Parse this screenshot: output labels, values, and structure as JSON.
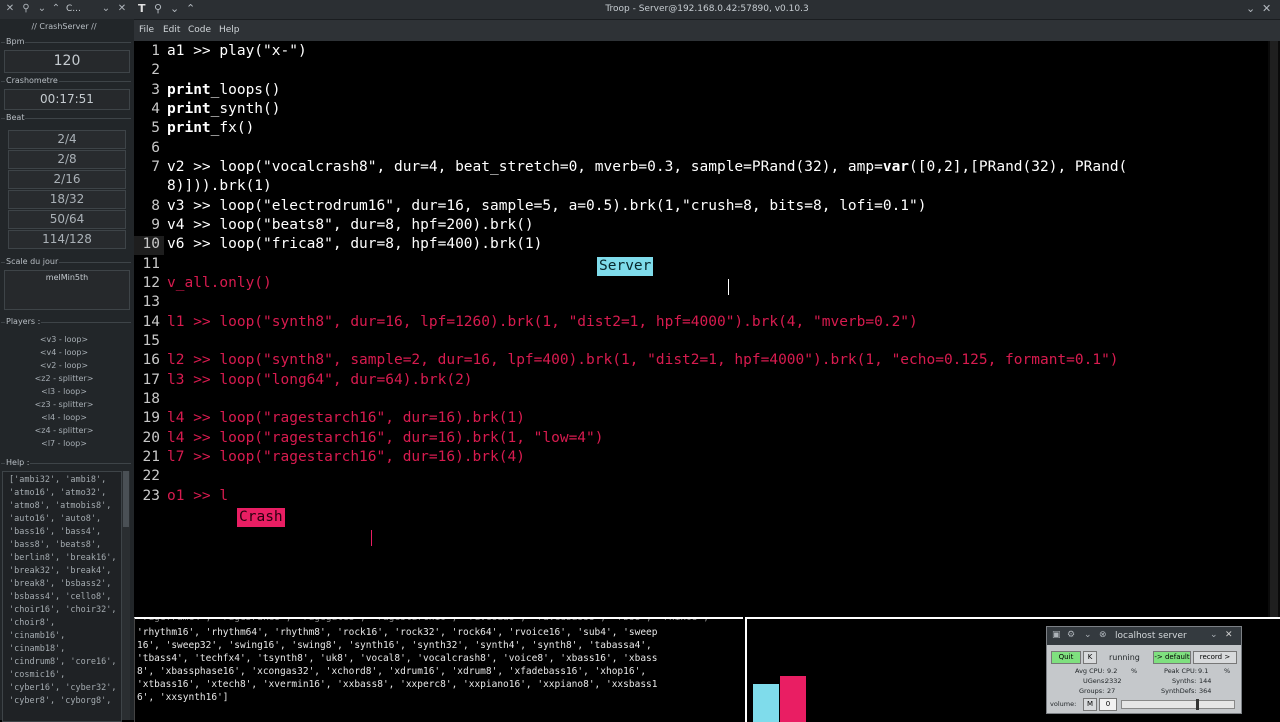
{
  "left_window": {
    "title": "// CrashServer //",
    "bpm_label": "Bpm",
    "bpm_value": "120",
    "chrono_label": "Crashometre",
    "chrono_value": "00:17:51",
    "beat_label": "Beat",
    "beat_buttons": [
      "2/4",
      "2/8",
      "2/16",
      "18/32",
      "50/64",
      "114/128"
    ],
    "scale_label": "Scale du jour",
    "scale_value": "melMin5th",
    "players_label": "Players :",
    "players": [
      "<v3 - loop>",
      "<v4 - loop>",
      "<v2 - loop>",
      "<z2 - splitter>",
      "<l3 - loop>",
      "<z3 - splitter>",
      "<l4 - loop>",
      "<z4 - splitter>",
      "<l7 - loop>"
    ],
    "help_label": "Help :",
    "help_lines": [
      "['ambi32', 'ambi8',",
      "'atmo16', 'atmo32',",
      "'atmo8', 'atmobis8',",
      "'auto16', 'auto8',",
      "'bass16', 'bass4',",
      "'bass8', 'beats8',",
      "'berlin8', 'break16',",
      "'break32', 'break4',",
      "'break8', 'bsbass2',",
      "'bsbass4', 'cello8',",
      "'choir16', 'choir32',",
      "'choir8',",
      "'cinamb16',",
      "'cinamb18',",
      "'cindrum8', 'core16',",
      "'cosmic16',",
      "'cyber16', 'cyber32',",
      "'cyber8', 'cyborg8',"
    ]
  },
  "troop": {
    "title": "Troop - Server@192.168.0.42:57890, v0.10.3",
    "menu": [
      "File",
      "Edit",
      "Code",
      "Help"
    ],
    "lines": [
      {
        "n": "1",
        "text": "a1 >> play(\"x-\")",
        "color": "white"
      },
      {
        "n": "2",
        "text": "",
        "color": "white"
      },
      {
        "n": "3",
        "kw": "print",
        "text": "_loops()",
        "color": "white"
      },
      {
        "n": "4",
        "kw": "print",
        "text": "_synth()",
        "color": "white"
      },
      {
        "n": "5",
        "kw": "print",
        "text": "_fx()",
        "color": "white"
      },
      {
        "n": "6",
        "text": "",
        "color": "white"
      },
      {
        "n": "7",
        "text": "v2 >> loop(\"vocalcrash8\", dur=4, beat_stretch=0, mverb=0.3, sample=PRand(32), amp=",
        "kw2": "var",
        "text2": "([0,2],[PRand(32), PRand(",
        "color": "white"
      },
      {
        "n": "",
        "text": "8)])).brk(1)",
        "color": "white"
      },
      {
        "n": "8",
        "text": "v3 >> loop(\"electrodrum16\", dur=16, sample=5, a=0.5).brk(1,\"crush=8, bits=8, lofi=0.1\")",
        "color": "white"
      },
      {
        "n": "9",
        "text": "v4 >> loop(\"beats8\", dur=8, hpf=200).brk()",
        "color": "white"
      },
      {
        "n": "10",
        "text": "v6 >> loop(\"frica8\", dur=8, hpf=400).brk(1)",
        "color": "white"
      },
      {
        "n": "11",
        "text": "",
        "color": "white"
      },
      {
        "n": "12",
        "text": "v_all.only()",
        "color": "pink"
      },
      {
        "n": "13",
        "text": "",
        "color": "white"
      },
      {
        "n": "14",
        "text": "l1 >> loop(\"synth8\", dur=16, lpf=1260).brk(1, \"dist2=1, hpf=4000\").brk(4, \"mverb=0.2\")",
        "color": "pink"
      },
      {
        "n": "15",
        "text": "",
        "color": "white"
      },
      {
        "n": "16",
        "text": "l2 >> loop(\"synth8\", sample=2, dur=16, lpf=400).brk(1, \"dist2=1, hpf=4000\").brk(1, \"echo=0.125, formant=0.1\")",
        "color": "pink"
      },
      {
        "n": "17",
        "text": "l3 >> loop(\"long64\", dur=64).brk(2)",
        "color": "pink"
      },
      {
        "n": "18",
        "text": "",
        "color": "white"
      },
      {
        "n": "19",
        "text": "l4 >> loop(\"ragestarch16\", dur=16).brk(1)",
        "color": "pink"
      },
      {
        "n": "20",
        "text": "l4 >> loop(\"ragestarch16\", dur=16).brk(1, \"low=4\")",
        "color": "pink"
      },
      {
        "n": "21",
        "text": "l7 >> loop(\"ragestarch16\", dur=16).brk(4)",
        "color": "pink"
      },
      {
        "n": "22",
        "text": "",
        "color": "white"
      },
      {
        "n": "23",
        "text": "o1 >> l",
        "color": "pink"
      }
    ],
    "tag_server": "Server",
    "tag_crash": "Crash",
    "server_color": "#7fdceb",
    "crash_color": "#e91e63",
    "code_pink": "#d81b4f"
  },
  "console": {
    "lines": [
      "'rhythm16', 'rhythm64', 'rhythm8', 'rock16', 'rock32', 'rock64', 'rvoice16', 'sub4', 'sweep",
      "16', 'sweep32', 'swing16', 'swing8', 'synth16', 'synth32', 'synth4', 'synth8', 'tabassa4',",
      "'tbass4', 'techfx4', 'tsynth8', 'uk8', 'vocal8', 'vocalcrash8', 'voice8', 'xbass16', 'xbass",
      "8', 'xbassphase16', 'xcongas32', 'xchord8', 'xdrum16', 'xdrum8', 'xfadebass16', 'xhop16',",
      "'xtbass16', 'xtech8', 'xvermin16', 'xxbass8', 'xxperc8', 'xxpiano16', 'xxpiano8', 'xxsbass1",
      "6', 'xxsynth16']"
    ]
  },
  "graph": {
    "bars": [
      {
        "color": "#7fdceb",
        "level": 0.38
      },
      {
        "color": "#e91e63",
        "level": 0.46
      }
    ]
  },
  "sc_server": {
    "title": "localhost server",
    "quit": "Quit",
    "k": "K",
    "status": "running",
    "default": "-> default",
    "record": "record >",
    "avg_cpu_label": "Avg CPU:",
    "avg_cpu": "9.2",
    "peak_cpu_label": "Peak CPU:",
    "peak_cpu": "9.1",
    "percent": "%",
    "ugens_label": "UGens:",
    "ugens": "2332",
    "synths_label": "Synths:",
    "synths": "144",
    "groups_label": "Groups:",
    "groups": "27",
    "synthdefs_label": "SynthDefs:",
    "synthdefs": "364",
    "volume_label": "volume:",
    "mute": "M",
    "volume": "0"
  }
}
